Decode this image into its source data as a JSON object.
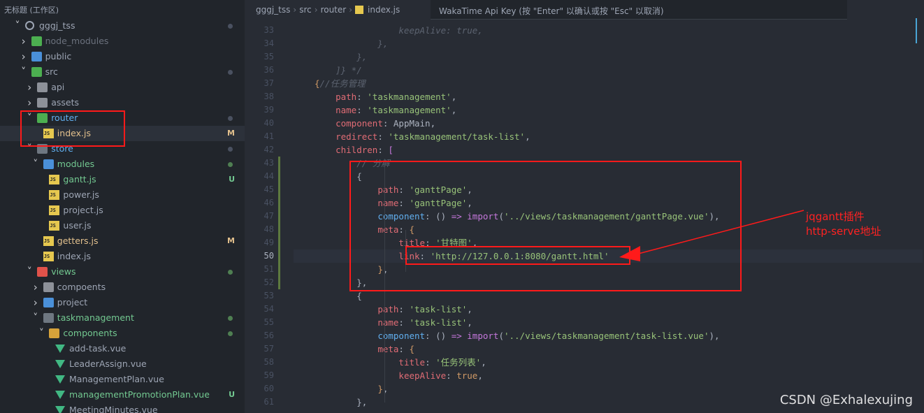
{
  "workspace": {
    "title": "无标题 (工作区)"
  },
  "tree": [
    {
      "label": "gggj_tss",
      "chevron": "down",
      "icon": "repo-icon",
      "indent": 0,
      "status": "dot"
    },
    {
      "label": "node_modules",
      "chevron": "right",
      "icon": "folder-icon",
      "indent": 1,
      "status": "",
      "dim": true
    },
    {
      "label": "public",
      "chevron": "right",
      "icon": "folder-icon",
      "indent": 1,
      "status": ""
    },
    {
      "label": "src",
      "chevron": "down",
      "icon": "folder-open-icon",
      "indent": 1,
      "status": "dot"
    },
    {
      "label": "api",
      "chevron": "right",
      "icon": "folder-icon",
      "indent": 2,
      "status": ""
    },
    {
      "label": "assets",
      "chevron": "right",
      "icon": "folder-icon",
      "indent": 2,
      "status": ""
    },
    {
      "label": "router",
      "chevron": "down",
      "icon": "folder-open-icon",
      "indent": 2,
      "status": "dot",
      "color": "blue"
    },
    {
      "label": "index.js",
      "chevron": "",
      "icon": "js-file-icon",
      "indent": 3,
      "status": "M",
      "selected": true
    },
    {
      "label": "store",
      "chevron": "down",
      "icon": "folder-open-icon",
      "indent": 2,
      "status": "dot",
      "color": "blue"
    },
    {
      "label": "modules",
      "chevron": "down",
      "icon": "folder-open-icon",
      "indent": 3,
      "status": "dot",
      "color": "green"
    },
    {
      "label": "gantt.js",
      "chevron": "",
      "icon": "js-file-icon",
      "indent": 4,
      "status": "U"
    },
    {
      "label": "power.js",
      "chevron": "",
      "icon": "js-file-icon",
      "indent": 4,
      "status": ""
    },
    {
      "label": "project.js",
      "chevron": "",
      "icon": "js-file-icon",
      "indent": 4,
      "status": ""
    },
    {
      "label": "user.js",
      "chevron": "",
      "icon": "js-file-icon",
      "indent": 4,
      "status": ""
    },
    {
      "label": "getters.js",
      "chevron": "",
      "icon": "js-file-icon",
      "indent": 3,
      "status": "M"
    },
    {
      "label": "index.js",
      "chevron": "",
      "icon": "js-file-icon",
      "indent": 3,
      "status": ""
    },
    {
      "label": "views",
      "chevron": "down",
      "icon": "folder-open-icon",
      "indent": 2,
      "status": "dot",
      "color": "green"
    },
    {
      "label": "compoents",
      "chevron": "right",
      "icon": "folder-icon",
      "indent": 3,
      "status": ""
    },
    {
      "label": "project",
      "chevron": "right",
      "icon": "folder-icon",
      "indent": 3,
      "status": ""
    },
    {
      "label": "taskmanagement",
      "chevron": "down",
      "icon": "folder-open-icon",
      "indent": 3,
      "status": "dot",
      "color": "green"
    },
    {
      "label": "components",
      "chevron": "down",
      "icon": "folder-open-icon",
      "indent": 4,
      "status": "dot",
      "color": "green"
    },
    {
      "label": "add-task.vue",
      "chevron": "",
      "icon": "vue-file-icon",
      "indent": 5,
      "status": ""
    },
    {
      "label": "LeaderAssign.vue",
      "chevron": "",
      "icon": "vue-file-icon",
      "indent": 5,
      "status": ""
    },
    {
      "label": "ManagementPlan.vue",
      "chevron": "",
      "icon": "vue-file-icon",
      "indent": 5,
      "status": ""
    },
    {
      "label": "managementPromotionPlan.vue",
      "chevron": "",
      "icon": "vue-file-icon",
      "indent": 5,
      "status": "U",
      "color": "green"
    },
    {
      "label": "MeetingMinutes.vue",
      "chevron": "",
      "icon": "vue-file-icon",
      "indent": 5,
      "status": ""
    }
  ],
  "breadcrumb": [
    "gggj_tss",
    "src",
    "router",
    "index.js"
  ],
  "command_input": {
    "placeholder": "WakaTime Api Key (按 \"Enter\" 以确认或按 \"Esc\" 以取消)"
  },
  "code_lines": [
    {
      "n": "33",
      "t": [
        [
          "c",
          "                keepAlive: true,"
        ]
      ]
    },
    {
      "n": "34",
      "t": [
        [
          "c",
          "            },"
        ]
      ]
    },
    {
      "n": "35",
      "t": [
        [
          "c",
          "        },"
        ]
      ]
    },
    {
      "n": "36",
      "t": [
        [
          "c",
          "    ]} */"
        ]
      ]
    },
    {
      "n": "37",
      "t": [
        [
          "b",
          "{"
        ],
        [
          "c",
          "//任务管理"
        ]
      ]
    },
    {
      "n": "38",
      "t": [
        [
          "p",
          "    "
        ],
        [
          "k",
          "path"
        ],
        [
          "p",
          ": "
        ],
        [
          "s",
          "'taskmanagement'"
        ],
        [
          "p",
          ","
        ]
      ]
    },
    {
      "n": "39",
      "t": [
        [
          "p",
          "    "
        ],
        [
          "k",
          "name"
        ],
        [
          "p",
          ": "
        ],
        [
          "s",
          "'taskmanagement'"
        ],
        [
          "p",
          ","
        ]
      ]
    },
    {
      "n": "40",
      "t": [
        [
          "p",
          "    "
        ],
        [
          "k",
          "component"
        ],
        [
          "p",
          ": AppMain,"
        ]
      ]
    },
    {
      "n": "41",
      "t": [
        [
          "p",
          "    "
        ],
        [
          "k",
          "redirect"
        ],
        [
          "p",
          ": "
        ],
        [
          "s",
          "'taskmanagement/task-list'"
        ],
        [
          "p",
          ","
        ]
      ]
    },
    {
      "n": "42",
      "t": [
        [
          "p",
          "    "
        ],
        [
          "k",
          "children"
        ],
        [
          "p",
          ": "
        ],
        [
          "kw",
          "["
        ]
      ]
    },
    {
      "n": "43",
      "t": [
        [
          "c",
          "        // 分解"
        ]
      ]
    },
    {
      "n": "44",
      "t": [
        [
          "p",
          "        {"
        ]
      ]
    },
    {
      "n": "45",
      "t": [
        [
          "p",
          "            "
        ],
        [
          "k",
          "path"
        ],
        [
          "p",
          ": "
        ],
        [
          "s",
          "'ganttPage'"
        ],
        [
          "p",
          ","
        ]
      ]
    },
    {
      "n": "46",
      "t": [
        [
          "p",
          "            "
        ],
        [
          "k",
          "name"
        ],
        [
          "p",
          ": "
        ],
        [
          "s",
          "'ganttPage'"
        ],
        [
          "p",
          ","
        ]
      ]
    },
    {
      "n": "47",
      "t": [
        [
          "p",
          "            "
        ],
        [
          "f",
          "component"
        ],
        [
          "p",
          ": () "
        ],
        [
          "kw",
          "=>"
        ],
        [
          "p",
          " "
        ],
        [
          "kw",
          "import"
        ],
        [
          "p",
          "("
        ],
        [
          "s",
          "'../views/taskmanagement/ganttPage.vue'"
        ],
        [
          "p",
          "),"
        ]
      ]
    },
    {
      "n": "48",
      "t": [
        [
          "p",
          "            "
        ],
        [
          "k",
          "meta"
        ],
        [
          "p",
          ": "
        ],
        [
          "b",
          "{"
        ]
      ]
    },
    {
      "n": "49",
      "t": [
        [
          "p",
          "                "
        ],
        [
          "k",
          "title"
        ],
        [
          "p",
          ": "
        ],
        [
          "s",
          "'甘特图'"
        ],
        [
          "p",
          ","
        ]
      ]
    },
    {
      "n": "50",
      "t": [
        [
          "p",
          "                "
        ],
        [
          "k",
          "link"
        ],
        [
          "p",
          ": "
        ],
        [
          "s",
          "'http://127.0.0.1:8080/gantt.html'"
        ]
      ],
      "hl": true
    },
    {
      "n": "51",
      "t": [
        [
          "p",
          "            "
        ],
        [
          "b",
          "}"
        ],
        [
          "p",
          ","
        ]
      ]
    },
    {
      "n": "52",
      "t": [
        [
          "p",
          "        },"
        ]
      ]
    },
    {
      "n": "53",
      "t": [
        [
          "p",
          "        {"
        ]
      ]
    },
    {
      "n": "54",
      "t": [
        [
          "p",
          "            "
        ],
        [
          "k",
          "path"
        ],
        [
          "p",
          ": "
        ],
        [
          "s",
          "'task-list'"
        ],
        [
          "p",
          ","
        ]
      ]
    },
    {
      "n": "55",
      "t": [
        [
          "p",
          "            "
        ],
        [
          "k",
          "name"
        ],
        [
          "p",
          ": "
        ],
        [
          "s",
          "'task-list'"
        ],
        [
          "p",
          ","
        ]
      ]
    },
    {
      "n": "56",
      "t": [
        [
          "p",
          "            "
        ],
        [
          "f",
          "component"
        ],
        [
          "p",
          ": () "
        ],
        [
          "kw",
          "=>"
        ],
        [
          "p",
          " "
        ],
        [
          "kw",
          "import"
        ],
        [
          "p",
          "("
        ],
        [
          "s",
          "'../views/taskmanagement/task-list.vue'"
        ],
        [
          "p",
          "),"
        ]
      ]
    },
    {
      "n": "57",
      "t": [
        [
          "p",
          "            "
        ],
        [
          "k",
          "meta"
        ],
        [
          "p",
          ": "
        ],
        [
          "b",
          "{"
        ]
      ]
    },
    {
      "n": "58",
      "t": [
        [
          "p",
          "                "
        ],
        [
          "k",
          "title"
        ],
        [
          "p",
          ": "
        ],
        [
          "s",
          "'任务列表'"
        ],
        [
          "p",
          ","
        ]
      ]
    },
    {
      "n": "59",
      "t": [
        [
          "p",
          "                "
        ],
        [
          "k",
          "keepAlive"
        ],
        [
          "p",
          ": "
        ],
        [
          "b",
          "true"
        ],
        [
          "p",
          ","
        ]
      ]
    },
    {
      "n": "60",
      "t": [
        [
          "p",
          "            "
        ],
        [
          "b",
          "}"
        ],
        [
          "p",
          ","
        ]
      ]
    },
    {
      "n": "61",
      "t": [
        [
          "p",
          "        },"
        ]
      ]
    }
  ],
  "annotation": {
    "line1": "jqgantt插件",
    "line2": "http-serve地址"
  },
  "watermark": "CSDN @Exhalexujing",
  "colors": {
    "annotation": "#ff1a1a",
    "modified": "#e2c08d",
    "untracked": "#73c991"
  }
}
